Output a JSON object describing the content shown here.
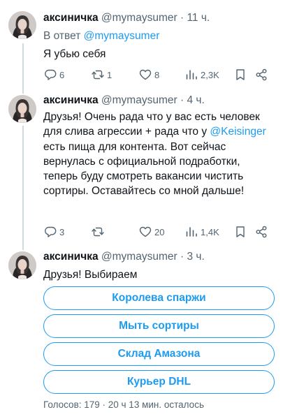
{
  "tweets": [
    {
      "author_name": "аксиничка",
      "handle": "@mymaysumer",
      "time": "11 ч.",
      "reply_prefix": "В ответ",
      "reply_to": "@mymaysumer",
      "text": "Я убью себя",
      "replies": "6",
      "retweets": "1",
      "likes": "8",
      "views": "2,3K"
    },
    {
      "author_name": "аксиничка",
      "handle": "@mymaysumer",
      "time": "4 ч.",
      "text_before": "Друзья! Очень рада что у вас есть человек для слива агрессии + рада что у ",
      "mention": "@Keisinger",
      "text_after": " есть пища для контента. Вот сейчас вернулась с официальной подработки, теперь буду смотреть вакансии чистить сортиры. Оставайтесь со мной дальше!",
      "replies": "3",
      "retweets": "",
      "likes": "20",
      "views": "1,4K"
    },
    {
      "author_name": "аксиничка",
      "handle": "@mymaysumer",
      "time": "3 ч.",
      "text": "Друзья! Выбираем",
      "poll_options": [
        "Королева спаржи",
        "Мыть сортиры",
        "Склад Амазона",
        "Курьер DHL"
      ],
      "poll_footer": "Голосов: 179 · 20 ч 13 мин. осталось"
    }
  ],
  "separator": "·",
  "icons": [
    "reply-icon",
    "retweet-icon",
    "like-icon",
    "views-icon",
    "bookmark-icon",
    "share-icon"
  ],
  "colors": {
    "accent": "#1d9bf0",
    "muted": "#536471",
    "text": "#0f1419",
    "thread": "#cfd9de"
  }
}
